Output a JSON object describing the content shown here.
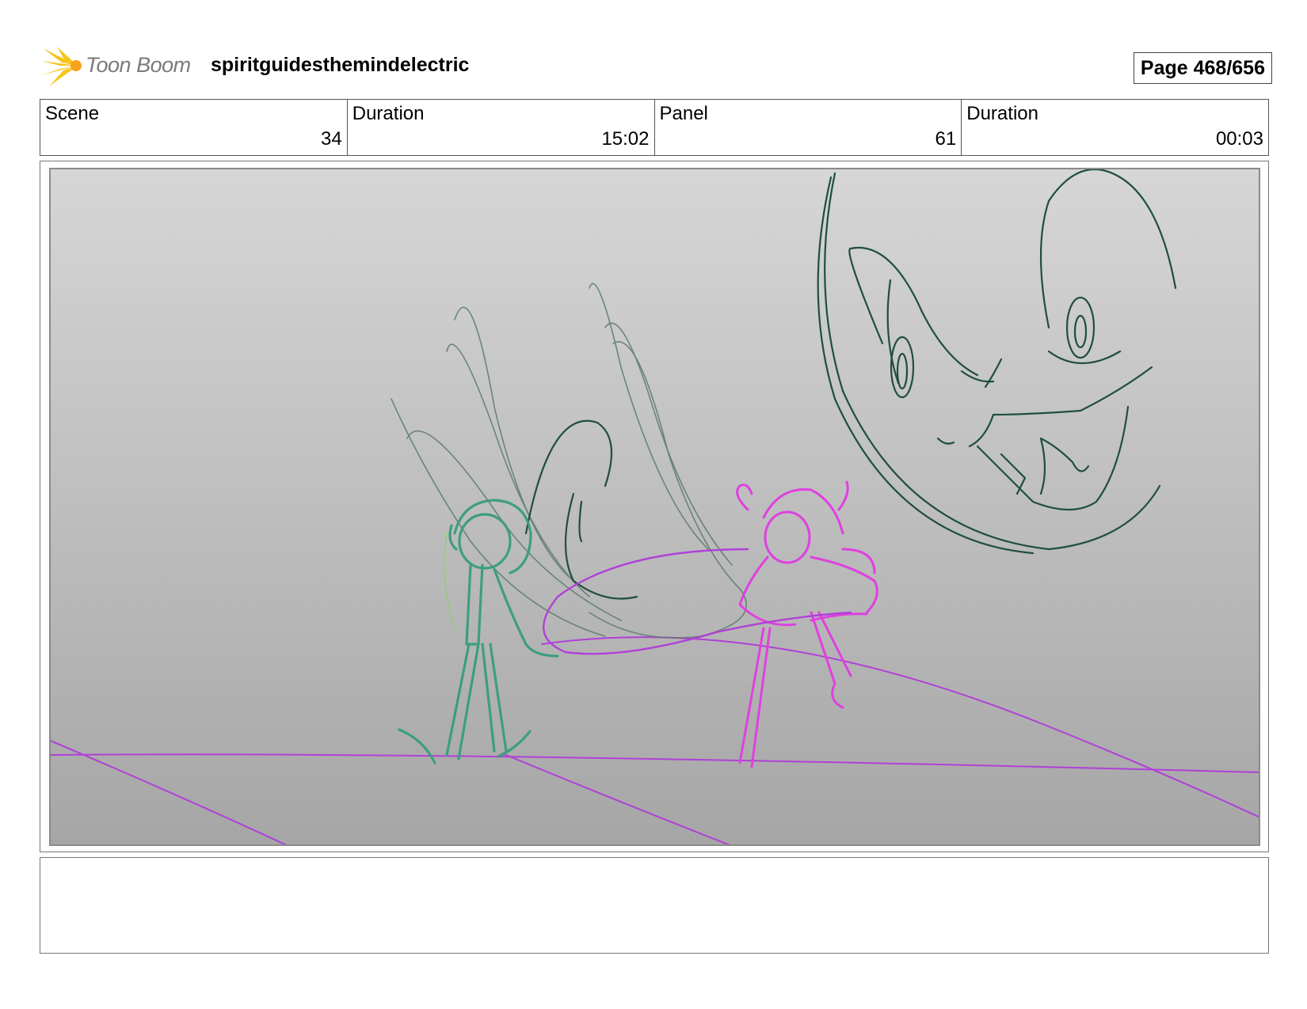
{
  "header": {
    "logo_text": "Toon Boom",
    "doc_title": "spiritguidesthemindelectric",
    "page": "Page 468/656"
  },
  "info": [
    {
      "label": "Scene",
      "value": "34"
    },
    {
      "label": "Duration",
      "value": "15:02"
    },
    {
      "label": "Panel",
      "value": "61"
    },
    {
      "label": "Duration",
      "value": "00:03"
    }
  ],
  "colors": {
    "green_sketch": "#3d9e7e",
    "dark_sketch": "#1f4f3a",
    "magenta_sketch": "#e040e0",
    "purple_line": "#b040d8",
    "logo_yellow": "#f6c51e"
  },
  "notes": ""
}
